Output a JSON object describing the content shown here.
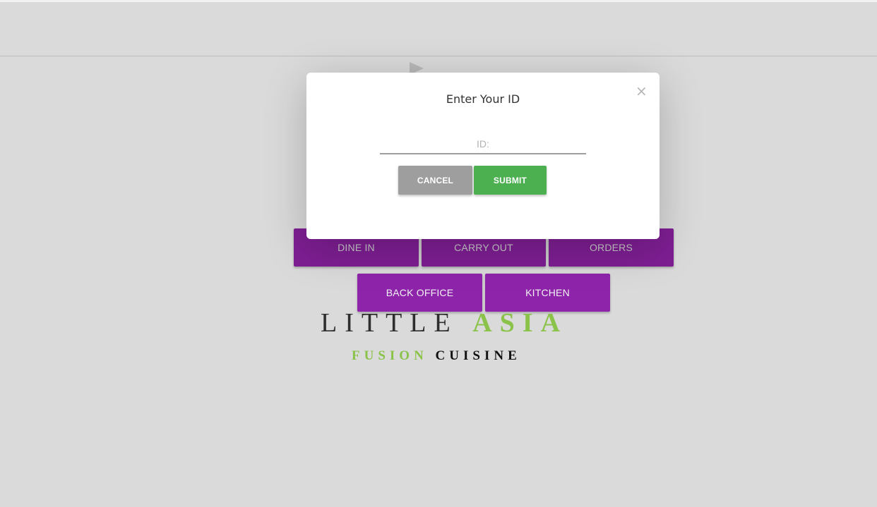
{
  "modal": {
    "title": "Enter Your ID",
    "close_symbol": "×",
    "id_placeholder": "ID:",
    "id_value": "",
    "cancel_label": "CANCEL",
    "submit_label": "SUBMIT"
  },
  "menu": {
    "tiles": [
      {
        "label": "DINE IN"
      },
      {
        "label": "CARRY OUT"
      },
      {
        "label": "ORDERS"
      },
      {
        "label": "BACK OFFICE"
      },
      {
        "label": "KITCHEN"
      }
    ]
  },
  "brand": {
    "name_dark": "LITTLE",
    "name_accent": "ASIA",
    "tagline_accent": "FUSION",
    "tagline_dark": "CUISINE"
  },
  "colors": {
    "background": "#dadada",
    "tile_purple": "#8e24aa",
    "brand_green": "#8bc34a",
    "submit_green": "#4caf50",
    "cancel_grey": "#9e9e9e"
  },
  "icons": {
    "close": "close-icon",
    "arrow": "play-arrow-icon"
  }
}
